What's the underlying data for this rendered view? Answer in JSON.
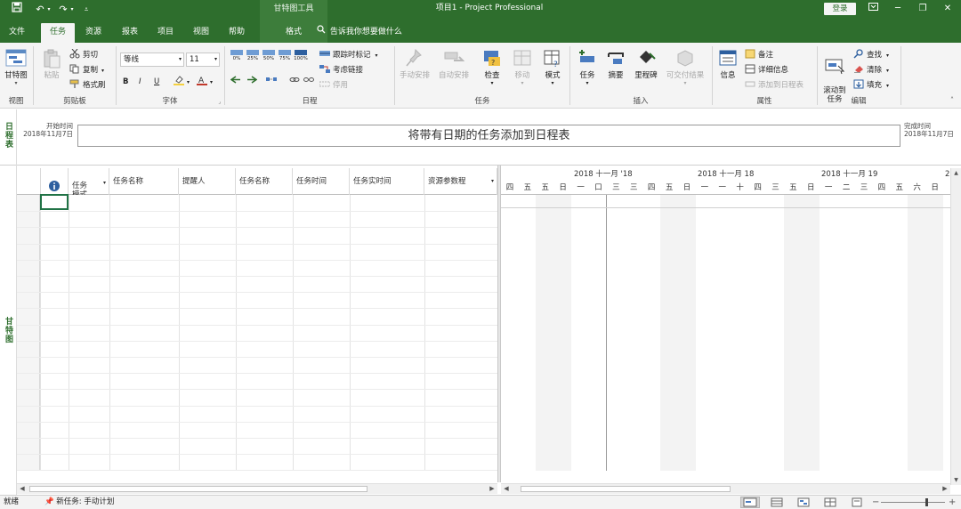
{
  "titlebar": {
    "context_tools": "甘特图工具",
    "document_title": "项目1 - Project Professional",
    "login": "登录",
    "save_icon": "save-icon",
    "undo_icon": "undo-icon",
    "redo_icon": "redo-icon",
    "customize_icon": "customize-qat-icon"
  },
  "tabs": {
    "file": "文件",
    "task": "任务",
    "resource": "资源",
    "report": "报表",
    "project": "项目",
    "view": "视图",
    "help": "帮助",
    "format": "格式",
    "tell_me": "告诉我你想要做什么"
  },
  "ribbon": {
    "view_group": {
      "gantt": "甘特图",
      "label": "视图"
    },
    "clipboard": {
      "paste": "粘贴",
      "cut": "剪切",
      "copy": "复制",
      "format_painter": "格式刷",
      "label": "剪贴板"
    },
    "font": {
      "font_name": "等线",
      "font_size": "11",
      "bold": "B",
      "italic": "I",
      "underline": "U",
      "label": "字体"
    },
    "schedule": {
      "pct": [
        "0%",
        "25%",
        "50%",
        "75%",
        "100%"
      ],
      "mark_on_track": "跟踪时标记",
      "respect_links": "考虑链接",
      "inactivate": "停用",
      "label": "日程"
    },
    "tasks": {
      "manual": "手动安排",
      "auto": "自动安排",
      "inspect": "检查",
      "move": "移动",
      "mode": "模式",
      "label": "任务"
    },
    "insert": {
      "task": "任务",
      "summary": "摘要",
      "milestone": "里程碑",
      "deliverable": "可交付结果",
      "label": "插入"
    },
    "properties": {
      "information": "信息",
      "notes": "备注",
      "details": "详细信息",
      "add_timeline": "添加到日程表",
      "label": "属性"
    },
    "editing": {
      "scroll_to_task": "滚动到\n任务",
      "find": "查找",
      "clear": "清除",
      "fill": "填充",
      "label": "编辑"
    }
  },
  "timeline": {
    "side_label": "日程表",
    "start_label": "开始时间",
    "start_date": "2018年11月7日",
    "bar_text": "将带有日期的任务添加到日程表",
    "finish_label": "完成时间",
    "finish_date": "2018年11月7日"
  },
  "gantt": {
    "side_label": "甘特图",
    "columns": [
      "任务\n模式",
      "任务名称",
      "提醒人",
      "任务名称",
      "任务时间",
      "任务实时间",
      "资源参数程"
    ],
    "weeks": [
      "2018 十一月 '18",
      "2018 十一月 18",
      "2018 十一月 19",
      "2"
    ],
    "days": [
      "四",
      "五",
      "五",
      "日",
      "一",
      "口",
      "三",
      "三",
      "四",
      "五",
      "日",
      "一",
      "一",
      "十",
      "四",
      "三",
      "五",
      "日",
      "一",
      "二",
      "三",
      "四",
      "五",
      "六",
      "日"
    ]
  },
  "status": {
    "ready": "就绪",
    "new_tasks": "新任务: 手动计划"
  }
}
